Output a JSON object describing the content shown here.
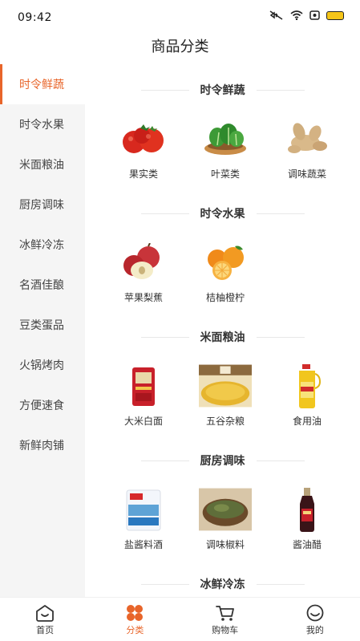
{
  "status_bar": {
    "time": "09:42"
  },
  "page_title": "商品分类",
  "sidebar": {
    "items": [
      {
        "label": "时令鲜蔬",
        "active": true
      },
      {
        "label": "时令水果",
        "active": false
      },
      {
        "label": "米面粮油",
        "active": false
      },
      {
        "label": "厨房调味",
        "active": false
      },
      {
        "label": "冰鲜冷冻",
        "active": false
      },
      {
        "label": "名酒佳酿",
        "active": false
      },
      {
        "label": "豆类蛋品",
        "active": false
      },
      {
        "label": "火锅烤肉",
        "active": false
      },
      {
        "label": "方便速食",
        "active": false
      },
      {
        "label": "新鲜肉铺",
        "active": false
      }
    ]
  },
  "sections": [
    {
      "title": "时令鲜蔬",
      "items": [
        {
          "label": "果实类",
          "icon": "tomato-image"
        },
        {
          "label": "叶菜类",
          "icon": "leafy-greens-image"
        },
        {
          "label": "调味蔬菜",
          "icon": "ginger-image"
        }
      ]
    },
    {
      "title": "时令水果",
      "items": [
        {
          "label": "苹果梨蕉",
          "icon": "apple-image"
        },
        {
          "label": "桔柚橙柠",
          "icon": "orange-image"
        }
      ]
    },
    {
      "title": "米面粮油",
      "items": [
        {
          "label": "大米白面",
          "icon": "rice-bag-image"
        },
        {
          "label": "五谷杂粮",
          "icon": "grain-image"
        },
        {
          "label": "食用油",
          "icon": "oil-bottle-image"
        }
      ]
    },
    {
      "title": "厨房调味",
      "items": [
        {
          "label": "盐酱料酒",
          "icon": "salt-bag-image"
        },
        {
          "label": "调味椒料",
          "icon": "pepper-bowl-image"
        },
        {
          "label": "酱油醋",
          "icon": "soy-sauce-image"
        }
      ]
    },
    {
      "title": "冰鲜冷冻",
      "items": []
    }
  ],
  "tabbar": {
    "items": [
      {
        "label": "首页",
        "icon": "home-icon",
        "active": false
      },
      {
        "label": "分类",
        "icon": "category-icon",
        "active": true
      },
      {
        "label": "购物车",
        "icon": "cart-icon",
        "active": false
      },
      {
        "label": "我的",
        "icon": "profile-icon",
        "active": false
      }
    ]
  },
  "colors": {
    "accent": "#e8652a",
    "sidebar_bg": "#f5f5f5"
  }
}
